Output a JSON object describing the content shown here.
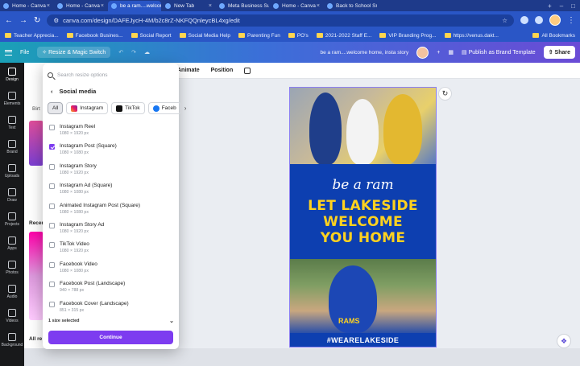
{
  "browser": {
    "tabs": [
      {
        "label": "Home - Canva",
        "active": false
      },
      {
        "label": "Home - Canva",
        "active": false
      },
      {
        "label": "be a ram....welcome",
        "active": true
      },
      {
        "label": "New Tab",
        "active": false
      },
      {
        "label": "Meta Business Suite",
        "active": false
      },
      {
        "label": "Home - Canva",
        "active": false
      },
      {
        "label": "Back to School Smile",
        "active": false
      }
    ],
    "url": "canva.com/design/DAFEJycH-4M/b2c8rZ-NKFQQnleycBL4xg/edit",
    "bookmarks": [
      "Teacher Apprecia...",
      "Facebook Busines...",
      "Social Report",
      "Social Media Help",
      "Parenting Fun",
      "PO's",
      "2021-2022 Staff E...",
      "VIP Branding Prog...",
      "https://venus.dakt..."
    ],
    "all_bookmarks_label": "All Bookmarks"
  },
  "canva_toolbar": {
    "file_label": "File",
    "resize_label": "Resize & Magic Switch",
    "doc_title": "be a ram....welcome home, insta story",
    "publish_label": "Publish as Brand Template",
    "share_label": "Share"
  },
  "rail": [
    {
      "label": "Design",
      "icon": "design-icon"
    },
    {
      "label": "Elements",
      "icon": "elements-icon"
    },
    {
      "label": "Text",
      "icon": "text-icon"
    },
    {
      "label": "Brand",
      "icon": "brand-icon"
    },
    {
      "label": "Uploads",
      "icon": "uploads-icon"
    },
    {
      "label": "Draw",
      "icon": "draw-icon"
    },
    {
      "label": "Projects",
      "icon": "projects-icon"
    },
    {
      "label": "Apps",
      "icon": "apps-icon"
    },
    {
      "label": "Photos",
      "icon": "photos-icon"
    },
    {
      "label": "Audio",
      "icon": "audio-icon"
    },
    {
      "label": "Videos",
      "icon": "videos-icon"
    },
    {
      "label": "Background",
      "icon": "background-icon"
    }
  ],
  "edit_tools": {
    "animate_label": "Animate",
    "position_label": "Position"
  },
  "side_panel": {
    "chip_text": "Birt",
    "recent_label": "Recen",
    "all_label": "All re"
  },
  "resize_modal": {
    "search_placeholder": "Search resize options",
    "section_title": "Social media",
    "chips": [
      "All",
      "Instagram",
      "TikTok",
      "Faceb"
    ],
    "options": [
      {
        "name": "Instagram Reel",
        "dims": "1080 × 1920 px",
        "checked": false
      },
      {
        "name": "Instagram Post (Square)",
        "dims": "1080 × 1080 px",
        "checked": true
      },
      {
        "name": "Instagram Story",
        "dims": "1080 × 1920 px",
        "checked": false
      },
      {
        "name": "Instagram Ad (Square)",
        "dims": "1080 × 1080 px",
        "checked": false
      },
      {
        "name": "Animated Instagram Post (Square)",
        "dims": "1080 × 1080 px",
        "checked": false
      },
      {
        "name": "Instagram Story Ad",
        "dims": "1080 × 1920 px",
        "checked": false
      },
      {
        "name": "TikTok Video",
        "dims": "1080 × 1920 px",
        "checked": false
      },
      {
        "name": "Facebook Video",
        "dims": "1080 × 1080 px",
        "checked": false
      },
      {
        "name": "Facebook Post (Landscape)",
        "dims": "940 × 788 px",
        "checked": false
      },
      {
        "name": "Facebook Cover (Landscape)",
        "dims": "851 × 315 px",
        "checked": false
      }
    ],
    "selected_count_label": "1 size selected",
    "continue_label": "Continue"
  },
  "design": {
    "script_text": "be a ram",
    "headline_lines": [
      "LET LAKESIDE",
      "WELCOME",
      "YOU HOME"
    ],
    "hashtag": "#WEARELAKESIDE",
    "shirt_text": "RAMS",
    "colors": {
      "blue": "#0d3fb0",
      "gold": "#ffd21f",
      "accent": "#7d3cf0"
    }
  }
}
